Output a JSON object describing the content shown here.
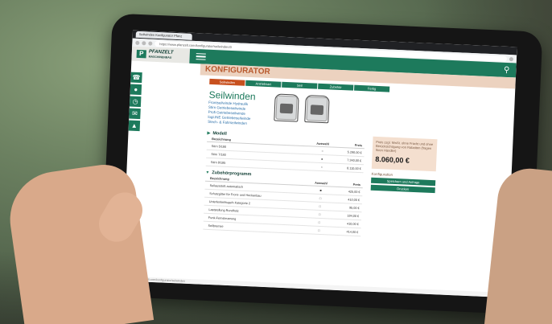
{
  "browser": {
    "tab_title": "Seilwinden Konfigurator Pfanz",
    "url": "https://www.pfanzelt.com/konfigurator/seilwinden/3"
  },
  "site": {
    "logo_mark": "P",
    "logo_name": "PFANZELT",
    "logo_sub": "MASCHINENBAU"
  },
  "page": {
    "title": "KONFIGURATOR",
    "steps": [
      {
        "label": "Seilwinden",
        "active": true
      },
      {
        "label": "Antriebsart",
        "active": false
      },
      {
        "label": "Seil",
        "active": false
      },
      {
        "label": "Zubehör",
        "active": false
      },
      {
        "label": "Fertig",
        "active": false
      }
    ],
    "hero": {
      "title": "Seilwinden",
      "lines": [
        "Frontseilwinde Hydraulik",
        "Stirn Getriebeseilwinde",
        "Profi Getriebeseilwinde",
        "logLINE Getriebeseilwinde",
        "Stech- & Fahrseilwinden"
      ]
    }
  },
  "model_section": {
    "title": "Modell",
    "headers": [
      "Bezeichnung",
      "Auswahl",
      "Preis"
    ],
    "rows": [
      {
        "name": "Stirn 5/180",
        "sel": "○",
        "price": "5.290,00 €"
      },
      {
        "name": "Stirn 7/180",
        "sel": "●",
        "price": "7.340,00 €"
      },
      {
        "name": "Stirn 8/185",
        "sel": "○",
        "price": "8.110,00 €"
      }
    ]
  },
  "accessory_section": {
    "title": "Zubehörprogramm",
    "headers": [
      "Bezeichnung",
      "Auswahl",
      "Preis"
    ],
    "rows": [
      {
        "name": "Seilausstoß automatisch",
        "sel": "■",
        "price": "425,00 €"
      },
      {
        "name": "Schutzgitter für Front- und Heckanbau",
        "sel": "□",
        "price": "410,00 €"
      },
      {
        "name": "Unterlenkerkugeln Kategorie 2",
        "sel": "□",
        "price": "95,00 €"
      },
      {
        "name": "Laststellung Rundholz",
        "sel": "□",
        "price": "184,00 €"
      },
      {
        "name": "Funk-Fernsteuerung",
        "sel": "□",
        "price": "410,00 €"
      },
      {
        "name": "Seilbremse",
        "sel": "□",
        "price": "414,00 €"
      }
    ]
  },
  "price_panel": {
    "note": "Preis zzgl. MwSt. ohne Fracht und ohne Berücksichtigung von Rabatten (fragen Ihren Händler)",
    "total": "8.060,00 €",
    "config_label": "Konfiguration",
    "save_button": "Speichern und Anfrage",
    "print_button": "Drucken"
  },
  "status_text": "https://www.pfanzelt.com/konfigurator/seilwinden"
}
